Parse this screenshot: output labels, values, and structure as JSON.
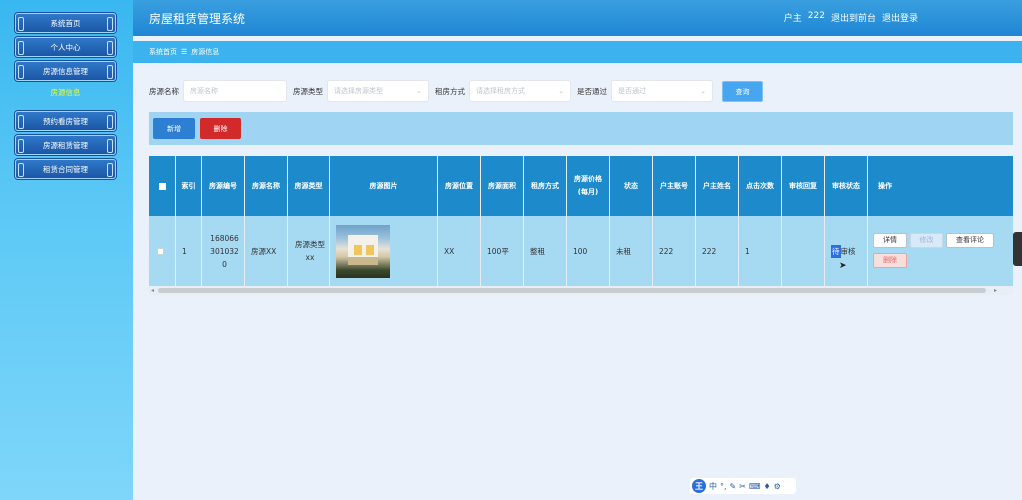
{
  "app": {
    "title": "房屋租赁管理系统"
  },
  "user": {
    "role_label": "户主",
    "name": "222",
    "front_link": "退出到前台",
    "logout_link": "退出登录"
  },
  "sidebar": {
    "items": [
      {
        "label": "系统首页"
      },
      {
        "label": "个人中心"
      },
      {
        "label": "房源信息管理"
      },
      {
        "label": "预约看房管理"
      },
      {
        "label": "房源租赁管理"
      },
      {
        "label": "租赁合同管理"
      }
    ],
    "active_sub": "房源信息"
  },
  "breadcrumb": {
    "home": "系统首页",
    "separator": "☰",
    "current": "房源信息"
  },
  "search": {
    "name_label": "房源名称",
    "name_placeholder": "房源名称",
    "type_label": "房源类型",
    "type_placeholder": "请选择房源类型",
    "mode_label": "租房方式",
    "mode_placeholder": "请选择租房方式",
    "pass_label": "是否通过",
    "pass_placeholder": "是否通过",
    "query_label": "查询"
  },
  "actions": {
    "add_label": "新增",
    "delete_label": "删除"
  },
  "table": {
    "headers": {
      "index": "索引",
      "code": "房源编号",
      "name": "房源名称",
      "type": "房源类型",
      "photo": "房源图片",
      "location": "房源位置",
      "area": "房源面积",
      "mode": "租房方式",
      "price": "房源价格(每月)",
      "status": "状态",
      "owner_account": "户主账号",
      "owner_name": "户主姓名",
      "clicks": "点击次数",
      "reply": "审核回复",
      "audit": "审核状态",
      "ops": "操作"
    },
    "rows": [
      {
        "index": "1",
        "code": "1680663010320",
        "name": "房源XX",
        "type": "房源类型xx",
        "location": "XX",
        "area": "100平",
        "mode": "整租",
        "price": "100",
        "status": "未租",
        "owner_account": "222",
        "owner_name": "222",
        "clicks": "1",
        "reply": "",
        "audit_selected": "待",
        "audit_rest": "审核",
        "btn_detail": "详情",
        "btn_edit": "修改",
        "btn_comment": "查看评论",
        "btn_delete": "删除"
      }
    ]
  },
  "ime": {
    "logo": "王",
    "zh": "中"
  },
  "colors": {
    "header": "#1d8acb",
    "row": "#a6d9f2",
    "sidebar": "#39b7f0",
    "danger": "#d22a2a",
    "primary": "#2d7fd3"
  }
}
